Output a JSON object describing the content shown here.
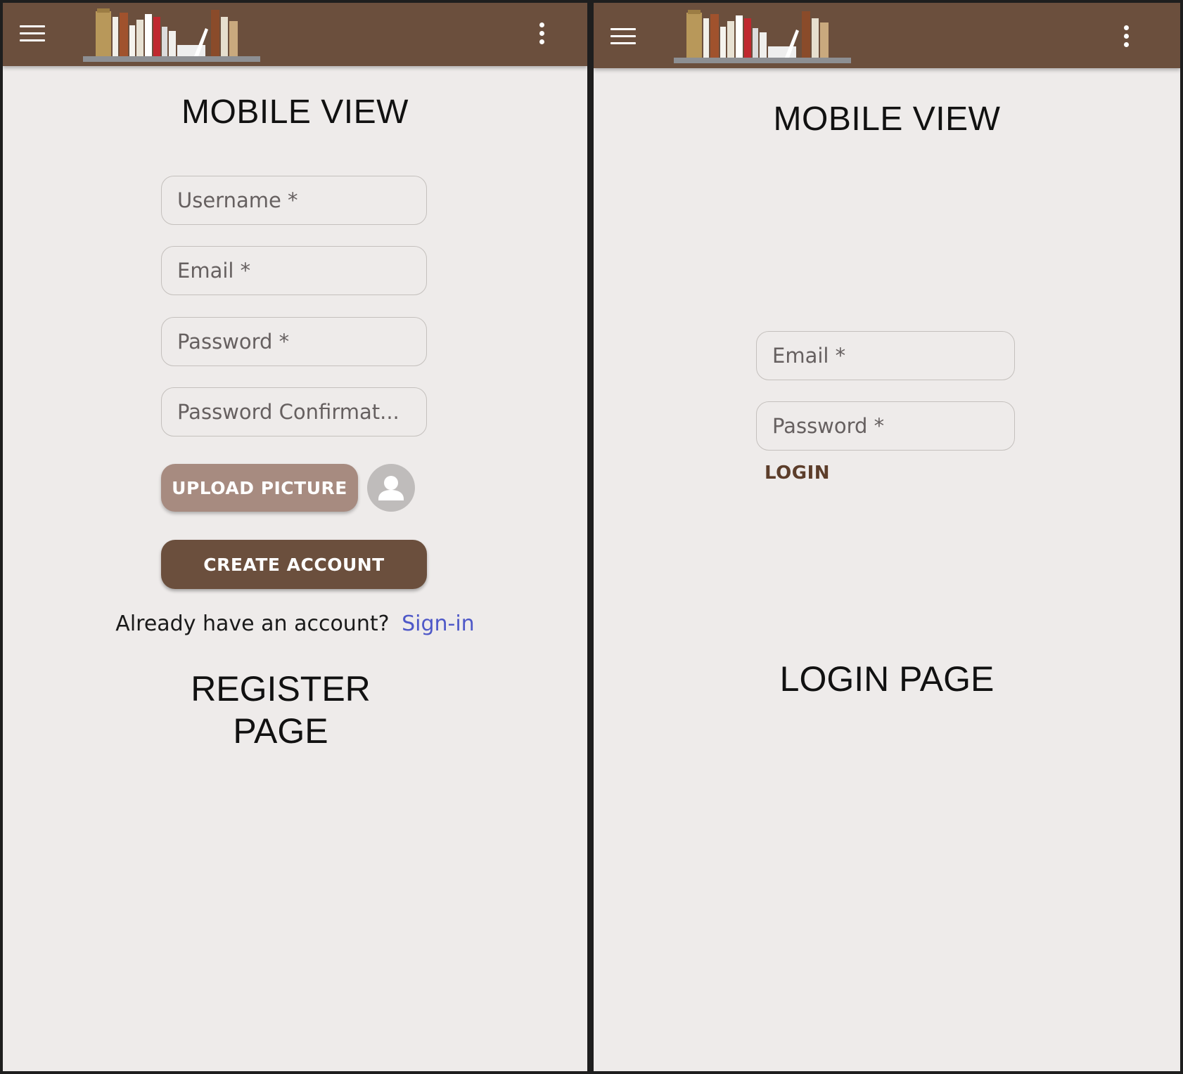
{
  "register_screen": {
    "header": {
      "menu_icon": "hamburger-menu-icon",
      "logo_image": "bookshelf-logo",
      "overflow_icon": "vertical-dots-icon"
    },
    "title": "MOBILE VIEW",
    "fields": {
      "username_placeholder": "Username *",
      "email_placeholder": "Email *",
      "password_placeholder": "Password *",
      "password_confirmation_placeholder": "Password Confirmat..."
    },
    "upload_button_label": "UPLOAD PICTURE",
    "avatar_icon": "person-avatar-icon",
    "create_account_label": "CREATE ACCOUNT",
    "already_text": "Already have an account?",
    "sign_in_link": "Sign-in",
    "caption_line1": "REGISTER",
    "caption_line2": "PAGE"
  },
  "login_screen": {
    "header": {
      "menu_icon": "hamburger-menu-icon",
      "logo_image": "bookshelf-logo",
      "overflow_icon": "vertical-dots-icon"
    },
    "title": "MOBILE VIEW",
    "fields": {
      "email_placeholder": "Email *",
      "password_placeholder": "Password *"
    },
    "login_label": "LOGIN",
    "caption": "LOGIN PAGE"
  },
  "colors": {
    "appbar": "#6b4f3d",
    "background": "#eeebea",
    "upload_button": "#a78b80",
    "primary_button": "#6b4f3d",
    "link": "#4e58c8"
  }
}
